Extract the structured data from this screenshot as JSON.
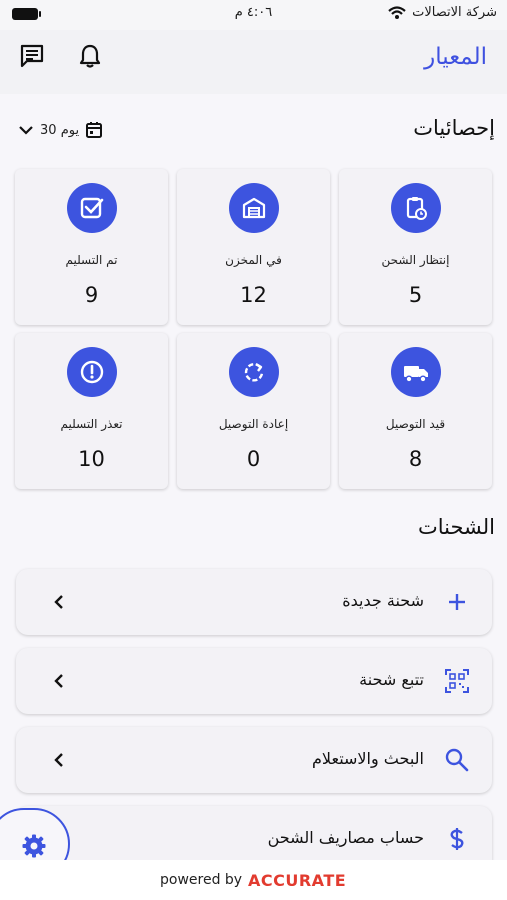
{
  "status": {
    "carrier": "شركة الاتصالات",
    "time": "٤:٠٦ م"
  },
  "header": {
    "brand": "المعيار"
  },
  "stats": {
    "title": "إحصائيات",
    "period": "30 يوم",
    "cards": [
      {
        "label": "إنتظار الشحن",
        "value": "5",
        "icon": "clipboard-clock-icon"
      },
      {
        "label": "في المخزن",
        "value": "12",
        "icon": "warehouse-icon"
      },
      {
        "label": "تم التسليم",
        "value": "9",
        "icon": "check-box-icon"
      },
      {
        "label": "قيد التوصيل",
        "value": "8",
        "icon": "truck-icon"
      },
      {
        "label": "إعادة التوصيل",
        "value": "0",
        "icon": "redo-icon"
      },
      {
        "label": "تعذر التسليم",
        "value": "10",
        "icon": "alert-icon"
      }
    ]
  },
  "shipments": {
    "title": "الشحنات",
    "items": [
      {
        "label": "شحنة جديدة",
        "icon": "plus-icon"
      },
      {
        "label": "تتبع شحنة",
        "icon": "qr-scan-icon"
      },
      {
        "label": "البحث والاستعلام",
        "icon": "search-icon"
      },
      {
        "label": "حساب مصاريف الشحن",
        "icon": "dollar-icon"
      }
    ]
  },
  "footer": {
    "powered": "powered by",
    "brand": "ACCURATE"
  },
  "colors": {
    "accent": "#3d54df",
    "brand_text": "#3f51e0",
    "footer_brand": "#e23b2f"
  }
}
